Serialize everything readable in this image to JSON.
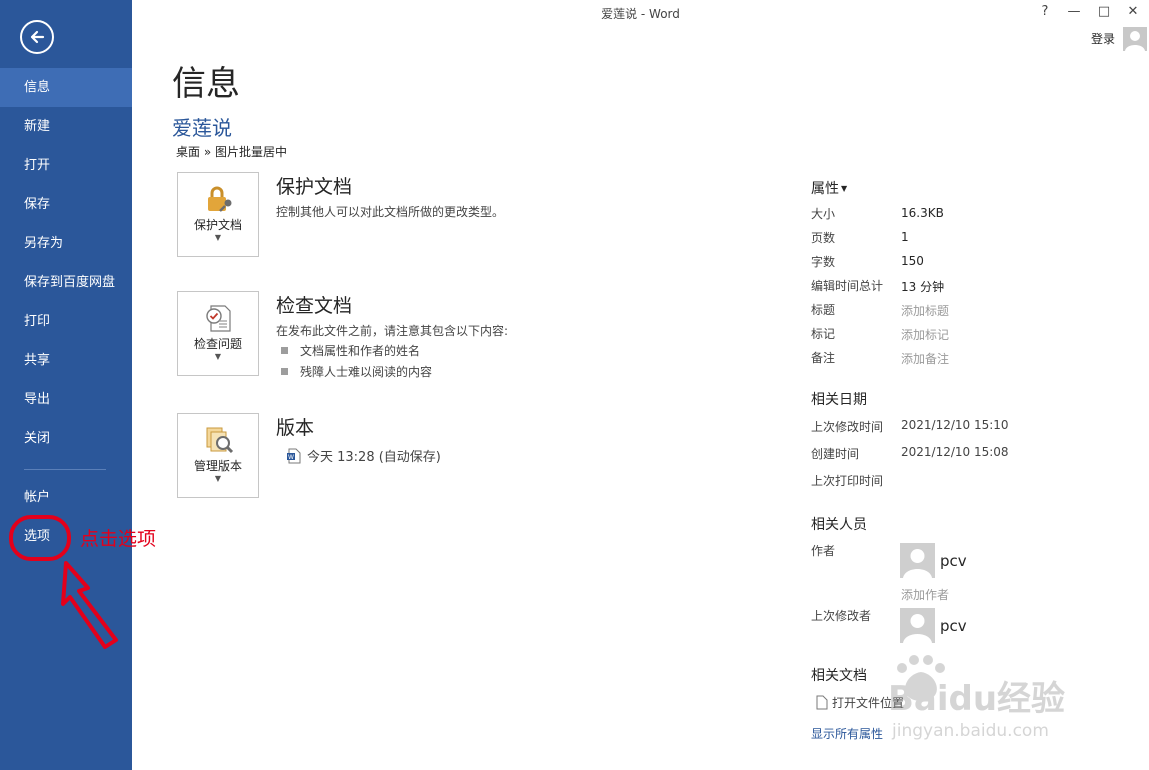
{
  "window": {
    "title": "爱莲说 - Word",
    "help": "?",
    "minimize": "—",
    "maximize": "□",
    "close": "✕",
    "login": "登录"
  },
  "sidebar": {
    "items": [
      {
        "label": "信息",
        "active": true
      },
      {
        "label": "新建"
      },
      {
        "label": "打开"
      },
      {
        "label": "保存"
      },
      {
        "label": "另存为"
      },
      {
        "label": "保存到百度网盘"
      },
      {
        "label": "打印"
      },
      {
        "label": "共享"
      },
      {
        "label": "导出"
      },
      {
        "label": "关闭"
      }
    ],
    "bottom": [
      {
        "label": "帐户"
      },
      {
        "label": "选项"
      }
    ]
  },
  "annotation": {
    "text": "点击选项",
    "color": "#e3001b"
  },
  "main": {
    "title": "信息",
    "doc_name": "爱莲说",
    "path": "桌面 » 图片批量居中",
    "protect": {
      "btn_label": "保护文档",
      "title": "保护文档",
      "desc": "控制其他人可以对此文档所做的更改类型。"
    },
    "inspect": {
      "btn_label": "检查问题",
      "title": "检查文档",
      "desc": "在发布此文件之前，请注意其包含以下内容:",
      "bullets": [
        "文档属性和作者的姓名",
        "残障人士难以阅读的内容"
      ]
    },
    "versions": {
      "btn_label": "管理版本",
      "title": "版本",
      "entry": "今天 13:28 (自动保存)"
    }
  },
  "properties": {
    "header": "属性",
    "rows": [
      {
        "label": "大小",
        "value": "16.3KB"
      },
      {
        "label": "页数",
        "value": "1"
      },
      {
        "label": "字数",
        "value": "150"
      },
      {
        "label": "编辑时间总计",
        "value": "13 分钟"
      },
      {
        "label": "标题",
        "value": "添加标题",
        "muted": true
      },
      {
        "label": "标记",
        "value": "添加标记",
        "muted": true
      },
      {
        "label": "备注",
        "value": "添加备注",
        "muted": true
      }
    ],
    "dates_header": "相关日期",
    "dates": [
      {
        "label": "上次修改时间",
        "value": "2021/12/10 15:10"
      },
      {
        "label": "创建时间",
        "value": "2021/12/10 15:08"
      },
      {
        "label": "上次打印时间",
        "value": ""
      }
    ],
    "people_header": "相关人员",
    "author_label": "作者",
    "author_name": "pcv",
    "add_author": "添加作者",
    "last_modified_label": "上次修改者",
    "last_modified_name": "pcv",
    "docs_header": "相关文档",
    "open_location": "打开文件位置",
    "show_all": "显示所有属性"
  },
  "watermark": {
    "text": "Baidu经验",
    "sub": "jingyan.baidu.com"
  },
  "colors": {
    "sidebar": "#2b579a",
    "sidebar_active": "#3e6db5",
    "accent": "#2b579a"
  }
}
